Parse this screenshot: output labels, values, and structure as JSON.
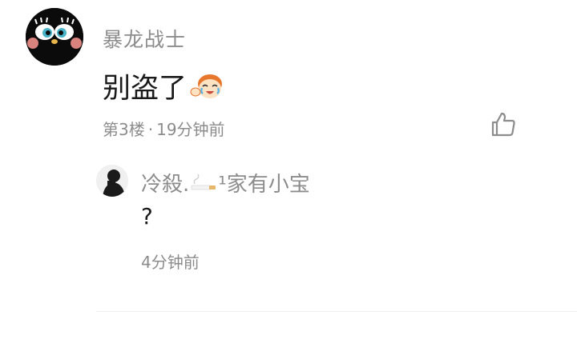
{
  "comment": {
    "username": "暴龙战士",
    "text": "别盗了",
    "emoji": "laughing-crying-emoji",
    "floor": "第3楼",
    "separator": "·",
    "time": "19分钟前",
    "like_icon": "thumbs-up-icon"
  },
  "reply": {
    "username_prefix": "冷殺.",
    "username_suffix": "¹家有小宝",
    "username_icon": "cigarette-icon",
    "text": "?",
    "time": "4分钟前"
  },
  "colors": {
    "meta_text": "#8c8c8c",
    "body_text": "#1a1a1a",
    "divider": "#eeeeee"
  }
}
